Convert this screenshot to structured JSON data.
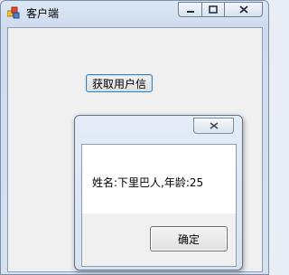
{
  "main_window": {
    "title": "客户端",
    "app_icon": "winforms-app-icon",
    "caption": {
      "minimize_icon": "minimize-icon",
      "maximize_icon": "maximize-icon",
      "close_icon": "close-icon"
    },
    "get_user_info_button": "获取用户信"
  },
  "message_box": {
    "close_icon": "close-icon",
    "message": "姓名:下里巴人,年龄:25",
    "ok_button": "确定"
  }
}
